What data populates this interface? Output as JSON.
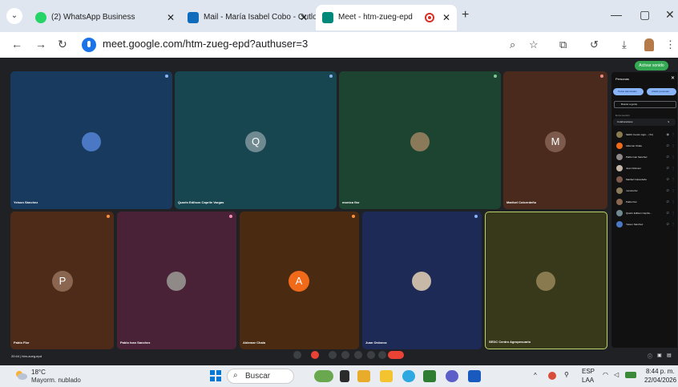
{
  "browser": {
    "tabs": [
      {
        "title": "(2) WhatsApp Business",
        "color": "#25d366"
      },
      {
        "title": "Mail - María Isabel Cobo - Outlook",
        "color": "#0f6cbd"
      },
      {
        "title": "Meet - htm-zueg-epd",
        "color": "#00897b"
      }
    ],
    "new_tab": "+",
    "close_glyph": "✕",
    "menu_glyph": "⌄",
    "url": "meet.google.com/htm-zueg-epd?authuser=3",
    "window_controls": [
      "—",
      "▢",
      "✕"
    ],
    "toolbar_icons": [
      "zoom-icon",
      "star-icon",
      "extensions-icon",
      "history-icon",
      "download-icon",
      "menu-icon"
    ]
  },
  "meet": {
    "companion_label": "Activar sonido",
    "meeting_time": "20:44  |  htm-zueg-epd",
    "participants": [
      {
        "name": "Yeison Sánchez",
        "bg": "#173a5e",
        "type": "photo",
        "avatar": "#4a78c4"
      },
      {
        "name": "Quarin Edilson Caprile Vargas",
        "bg": "#174651",
        "type": "letter",
        "letter": "Q",
        "avatar": "#6f8a90"
      },
      {
        "name": "monica flor",
        "bg": "#1d4431",
        "type": "photo",
        "avatar": "#8a7a5a"
      },
      {
        "name": "Maribel Colcerdeño",
        "bg": "#4a2a1c",
        "type": "letter",
        "letter": "M",
        "avatar": "#7d5a4c"
      },
      {
        "name": "Pablo Flor",
        "bg": "#4e2a18",
        "type": "letter",
        "letter": "P",
        "avatar": "#8a6650"
      },
      {
        "name": "Pablo Ivan Sanchez",
        "bg": "#4a2238",
        "type": "photo",
        "avatar": "#8f8a88"
      },
      {
        "name": "Aldemar Chala",
        "bg": "#4a2a10",
        "type": "letter",
        "letter": "A",
        "avatar": "#f06a1a"
      },
      {
        "name": "Juan Ordonez",
        "bg": "#1e2a56",
        "type": "photo",
        "avatar": "#c7b8a8"
      },
      {
        "name": "SEDC Centro Agropecuario",
        "bg": "#37391a",
        "type": "photo",
        "avatar": "#8a7a50"
      }
    ],
    "panel": {
      "title": "Personas",
      "add_button": "Añadir personas",
      "host_controls": "Todos silenciados",
      "search_placeholder": "Buscar a gente",
      "in_meeting": "En la reunión",
      "collaborators": "Colaboradores",
      "collab_count": "9",
      "people": [
        {
          "name": "SEDC Centro Agro... (Tú)",
          "avatar": "#8a7a50"
        },
        {
          "name": "Aldemar Chala",
          "avatar": "#f06a1a"
        },
        {
          "name": "Pablo Ivan Sanchez",
          "avatar": "#8f8a88"
        },
        {
          "name": "Juan Ordonez",
          "avatar": "#c7b8a8"
        },
        {
          "name": "Maribel Colcerdeño",
          "avatar": "#7d5a4c"
        },
        {
          "name": "monica flor",
          "avatar": "#8a7a5a"
        },
        {
          "name": "Pablo Flor",
          "avatar": "#8a6650"
        },
        {
          "name": "Quarin Edilson Caprile...",
          "avatar": "#6f8a90"
        },
        {
          "name": "Yeison Sánchez",
          "avatar": "#4a78c4"
        }
      ]
    }
  },
  "taskbar": {
    "weather_temp": "18°C",
    "weather_desc": "Mayorm. nublado",
    "search": "Buscar",
    "lang": "ESP",
    "lang2": "LAA",
    "time": "8:44 p. m.",
    "date": "22/04/2026"
  }
}
